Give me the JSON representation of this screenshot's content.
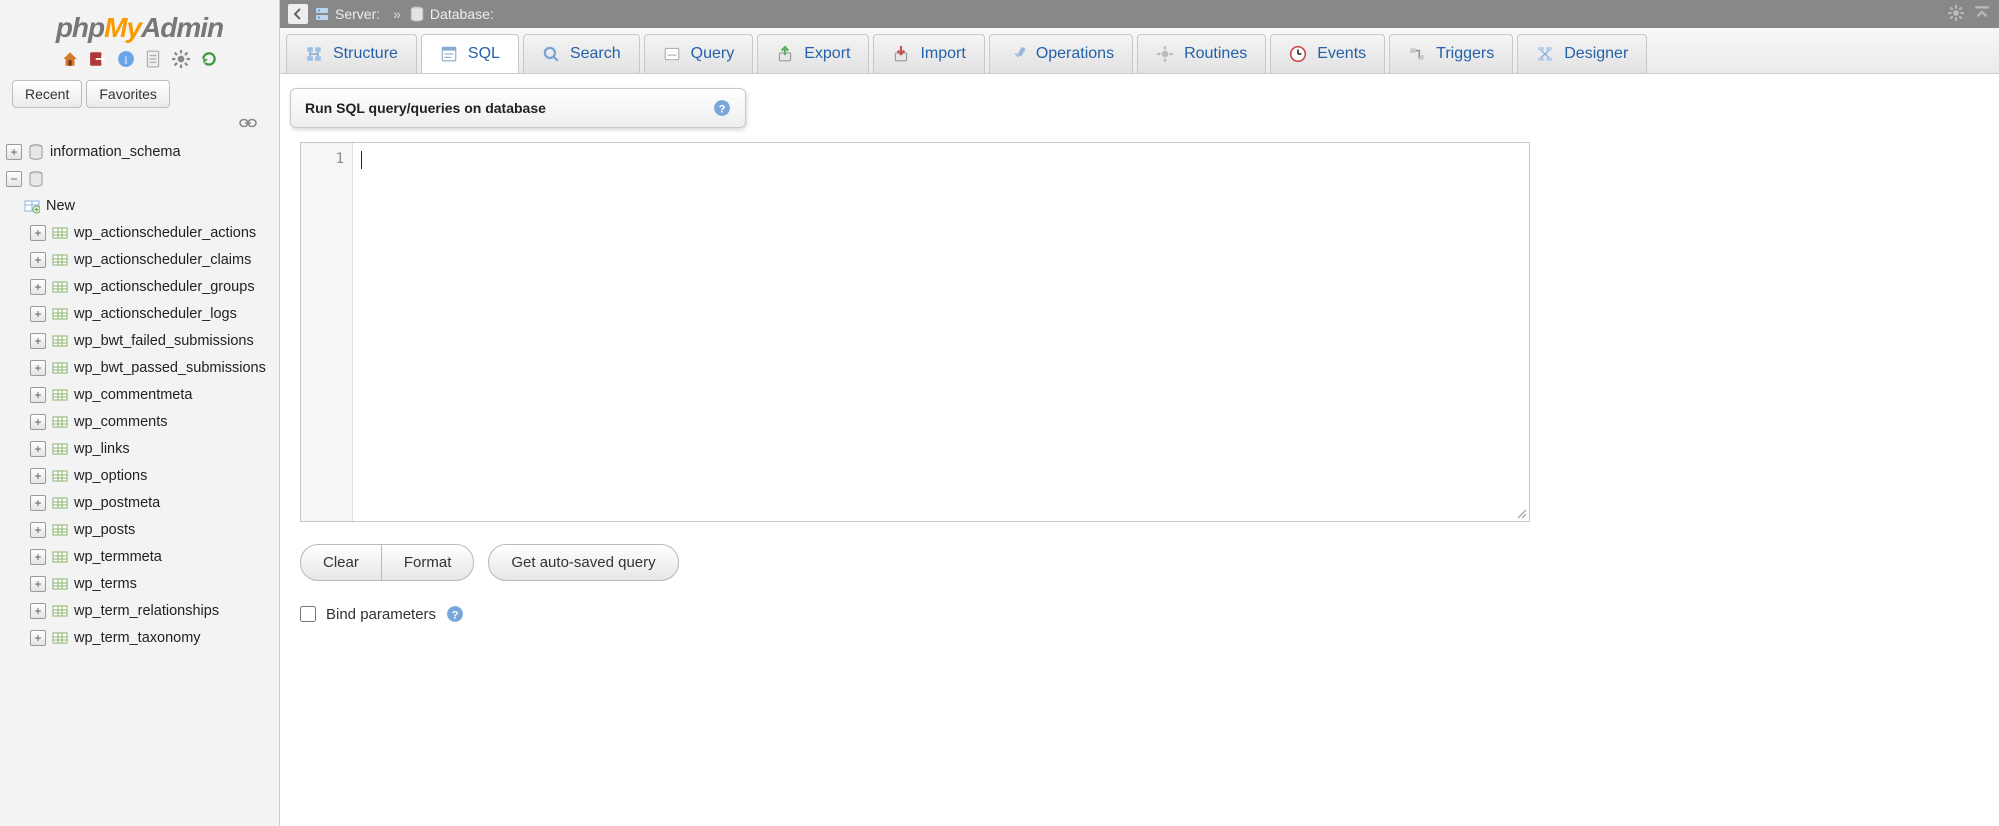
{
  "logo": {
    "php": "php",
    "my": "My",
    "admin": "Admin"
  },
  "sidebar": {
    "recent": "Recent",
    "favorites": "Favorites",
    "db_schema": "information_schema",
    "new_label": "New",
    "tables": [
      "wp_actionscheduler_actions",
      "wp_actionscheduler_claims",
      "wp_actionscheduler_groups",
      "wp_actionscheduler_logs",
      "wp_bwt_failed_submissions",
      "wp_bwt_passed_submissions",
      "wp_commentmeta",
      "wp_comments",
      "wp_links",
      "wp_options",
      "wp_postmeta",
      "wp_posts",
      "wp_termmeta",
      "wp_terms",
      "wp_term_relationships",
      "wp_term_taxonomy"
    ]
  },
  "breadcrumb": {
    "server_label": "Server:",
    "server_value": "",
    "separator": "»",
    "db_label": "Database:",
    "db_value": ""
  },
  "tabs": [
    {
      "id": "structure",
      "label": "Structure"
    },
    {
      "id": "sql",
      "label": "SQL",
      "active": true
    },
    {
      "id": "search",
      "label": "Search"
    },
    {
      "id": "query",
      "label": "Query"
    },
    {
      "id": "export",
      "label": "Export"
    },
    {
      "id": "import",
      "label": "Import"
    },
    {
      "id": "operations",
      "label": "Operations"
    },
    {
      "id": "routines",
      "label": "Routines"
    },
    {
      "id": "events",
      "label": "Events"
    },
    {
      "id": "triggers",
      "label": "Triggers"
    },
    {
      "id": "designer",
      "label": "Designer"
    }
  ],
  "panel": {
    "title": "Run SQL query/queries on database"
  },
  "editor": {
    "line_number": "1",
    "content": ""
  },
  "buttons": {
    "clear": "Clear",
    "format": "Format",
    "autosaved": "Get auto-saved query"
  },
  "bind": {
    "label": "Bind parameters"
  }
}
